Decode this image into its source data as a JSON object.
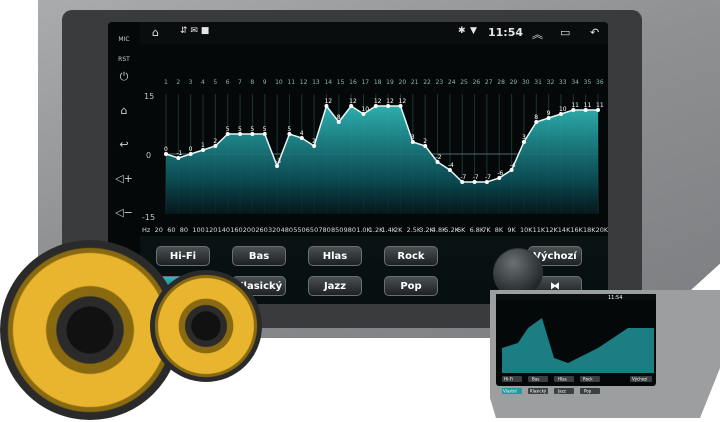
{
  "status": {
    "time": "11:54"
  },
  "sidebar": {
    "mic_label": "MIC",
    "rst_label": "RST"
  },
  "eq": {
    "bands": [
      1,
      2,
      3,
      4,
      5,
      6,
      7,
      8,
      9,
      10,
      11,
      12,
      13,
      14,
      15,
      16,
      17,
      18,
      19,
      20,
      21,
      22,
      23,
      24,
      25,
      26,
      27,
      28,
      29,
      30,
      31,
      32,
      33,
      34,
      35,
      36
    ],
    "values": [
      0,
      -1,
      0,
      1,
      2,
      5,
      5,
      5,
      5,
      -3,
      5,
      4,
      2,
      12,
      8,
      12,
      10,
      12,
      12,
      12,
      3,
      2,
      -2,
      -4,
      -7,
      -7,
      -7,
      -6,
      -4,
      3,
      8,
      9,
      10,
      11,
      11,
      11,
      11,
      10,
      9
    ],
    "shown_labels": [
      "12",
      "12",
      "14",
      "15",
      "16",
      "5",
      "5",
      "5",
      "5",
      "5",
      "4",
      "3",
      "12",
      "11",
      "11",
      "11",
      "11",
      "10",
      "9",
      "8",
      "10",
      "11",
      "-7",
      "-7",
      "-7",
      "-6",
      "-4",
      "0",
      "-1",
      "0",
      "1",
      "-3",
      "2"
    ],
    "ymax_label": "15",
    "yzero_label": "0",
    "ymin_label": "-15",
    "freq_labels": [
      "Hz",
      "20",
      "60",
      "80",
      "100",
      "120",
      "140",
      "160",
      "200",
      "260",
      "320",
      "480",
      "550",
      "650",
      "780",
      "850",
      "980",
      "1.0K",
      "1.2K",
      "1.4K",
      "2K",
      "2.5K",
      "3.2K",
      "4.8K",
      "5.2K",
      "6K",
      "6.8K",
      "7K",
      "8K",
      "9K",
      "10K",
      "11K",
      "12K",
      "14K",
      "16K",
      "18K",
      "20K"
    ]
  },
  "buttons": {
    "row1": [
      "Hi-Fi",
      "Bas",
      "Hlas",
      "Rock"
    ],
    "row2": [
      "",
      "Klasický",
      "Jazz",
      "Pop"
    ],
    "default_label": "Výchozí"
  },
  "tablet": {
    "time": "11:54",
    "row1": [
      "Hi-Fi",
      "Bas",
      "Hlas",
      "Rock",
      "Výchozí"
    ],
    "row2": [
      "Vlastní",
      "Klasický",
      "Jazz",
      "Pop"
    ]
  }
}
